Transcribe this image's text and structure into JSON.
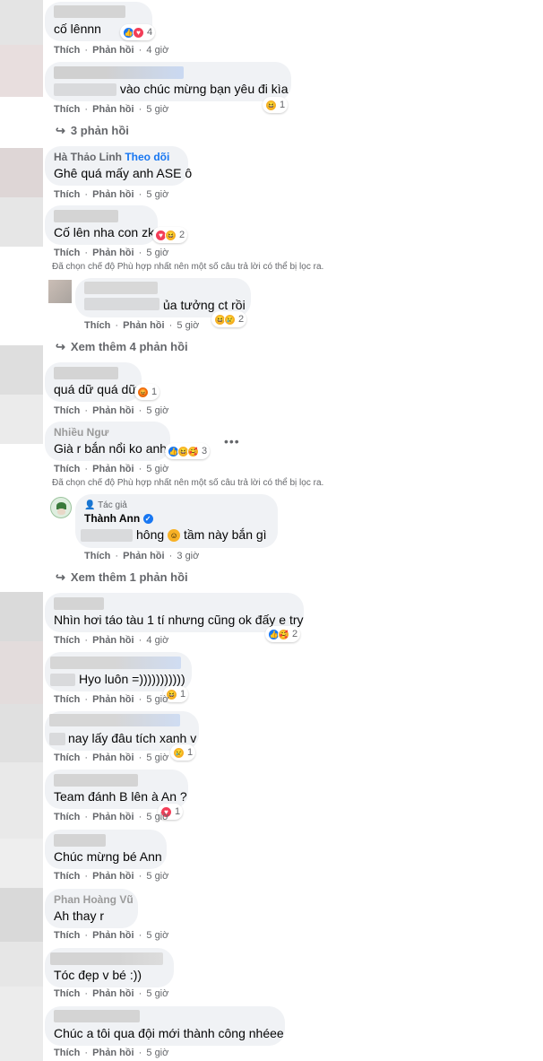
{
  "actions": {
    "like": "Thích",
    "reply": "Phản hồi",
    "sep": "·"
  },
  "comments": [
    {
      "text": "cố lênnn",
      "time": "4 giờ",
      "react_count": "4"
    },
    {
      "text": "vào chúc mừng bạn yêu đi kìa",
      "time": "5 giờ",
      "react_count": "1"
    },
    {
      "name": "Hà Thảo Linh",
      "name_extra": "Theo dõi",
      "text": "Ghê quá mấy anh ASE ô",
      "time": "5 giờ"
    },
    {
      "text": "Cố lên nha con zk",
      "time": "5 giờ",
      "react_count": "2"
    },
    {
      "text": "ủa tưởng ct rồi",
      "time": "5 giờ",
      "react_count": "2"
    },
    {
      "text": "quá dữ quá dữ",
      "time": "5 giờ",
      "react_count": "1"
    },
    {
      "name": "Nhiều Ngư",
      "text": "Già r bắn nổi ko anh",
      "time": "5 giờ",
      "react_count": "3"
    },
    {
      "badge": "Tác giả",
      "name": "Thành Ann",
      "text_a": "hông",
      "text_b": "tầm này bắn gì",
      "time": "3 giờ"
    },
    {
      "text": "Nhìn hơi táo tàu 1 tí nhưng cũng ok đấy e try",
      "time": "4 giờ",
      "react_count": "2"
    },
    {
      "text": "Hyo luôn =)))))))))))",
      "time": "5 giờ",
      "react_count": "1"
    },
    {
      "text": "nay lấy đâu tích xanh v",
      "time": "5 giờ",
      "react_count": "1"
    },
    {
      "text": "Team đánh B lên à An ?",
      "time": "5 giờ",
      "react_count": "1"
    },
    {
      "text": "Chúc mừng bé Ann",
      "time": "5 giờ"
    },
    {
      "name": "Phan Hoàng Vũ",
      "text": "Ah thay r",
      "time": "5 giờ"
    },
    {
      "text": "Tóc đẹp v bé :))",
      "time": "5 giờ"
    },
    {
      "text": "Chúc a tôi qua đội mới thành công nhéee",
      "time": "5 giờ"
    }
  ],
  "links": {
    "replies_3": "3 phản hồi",
    "more_4": "Xem thêm 4 phản hồi",
    "more_1": "Xem thêm 1 phản hồi"
  },
  "filter_note": "Đã chọn chế độ Phù hợp nhất nên một số câu trả lời có thể bị lọc ra.",
  "colors": {
    "bubble": "#f0f2f5",
    "meta": "#65676b",
    "like": "#1877f2",
    "love": "#f33e58",
    "haha": "#f7b125"
  }
}
